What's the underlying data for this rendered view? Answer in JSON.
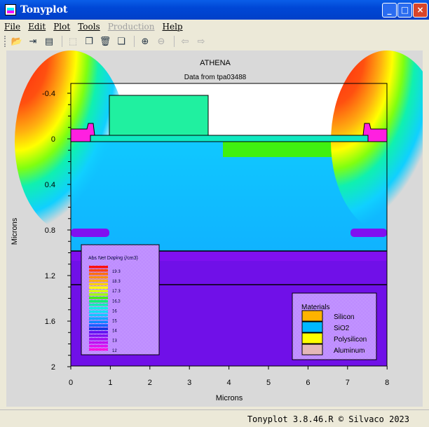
{
  "window": {
    "title": "Tonyplot",
    "buttons": [
      "_",
      "□",
      "×"
    ]
  },
  "menu": [
    "File",
    "Edit",
    "Plot",
    "Tools",
    "Production",
    "Help"
  ],
  "toolbar_icons": [
    "open-icon",
    "import-icon",
    "print-icon",
    "select-icon",
    "copy-icon",
    "delete-icon",
    "duplicate-icon",
    "zoom-in-icon",
    "zoom-out-icon",
    "previous-icon",
    "next-icon"
  ],
  "plot": {
    "title": "ATHENA",
    "subtitle": "Data from tpa03488",
    "xlabel": "Microns",
    "ylabel": "Microns",
    "xticks": [
      "0",
      "1",
      "2",
      "3",
      "4",
      "5",
      "6",
      "7",
      "8"
    ],
    "yticks": [
      "-0.4",
      "0",
      "0.4",
      "0.8",
      "1.2",
      "1.6",
      "2"
    ]
  },
  "doping_legend": {
    "title": "Abs Net Doping (/cm3)",
    "labels": [
      "19.3",
      "18.3",
      "17.3",
      "16.3",
      "16",
      "15",
      "14",
      "13",
      "12"
    ],
    "colors": [
      "#ff1010",
      "#ff4010",
      "#ff7010",
      "#ff9010",
      "#ffb010",
      "#ffd010",
      "#ffff00",
      "#d8ff10",
      "#a0ff10",
      "#40f010",
      "#10f070",
      "#10f0b0",
      "#10f0e0",
      "#10e0f0",
      "#10c8ff",
      "#10a8ff",
      "#1088ff",
      "#1060ff",
      "#1030e0",
      "#6010f0",
      "#8010f0",
      "#a010f0",
      "#c010f0",
      "#e010f0",
      "#ff10e0"
    ]
  },
  "materials_legend": {
    "title": "Materials",
    "items": [
      {
        "label": "Silicon",
        "color": "#ffb300"
      },
      {
        "label": "SiO2",
        "color": "#00b8ff"
      },
      {
        "label": "Polysilicon",
        "color": "#ffff00"
      },
      {
        "label": "Aluminum",
        "color": "#e4b8b8"
      }
    ]
  },
  "status": "Tonyplot 3.8.46.R © Silvaco 2023"
}
